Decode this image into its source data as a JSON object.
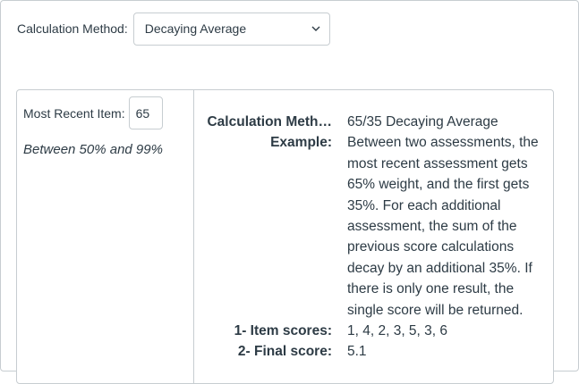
{
  "calculation": {
    "label": "Calculation Method:",
    "selected": "Decaying Average"
  },
  "most_recent": {
    "label": "Most Recent Item:",
    "value": "65",
    "range_hint": "Between 50% and 99%"
  },
  "details": {
    "method_key": "Calculation Meth…",
    "method_value": "65/35 Decaying Average",
    "example_key": "Example:",
    "example_value": "Between two assessments, the most recent assessment gets 65% weight, and the first gets 35%. For each additional assessment, the sum of the previous score calculations decay by an additional 35%. If there is only one result, the single score will be returned.",
    "item_scores_key": "1- Item scores:",
    "item_scores_value": "1, 4, 2, 3, 5, 3, 6",
    "final_score_key": "2- Final score:",
    "final_score_value": "5.1"
  },
  "icons": {
    "select_arrow": "chevron-down-icon"
  }
}
